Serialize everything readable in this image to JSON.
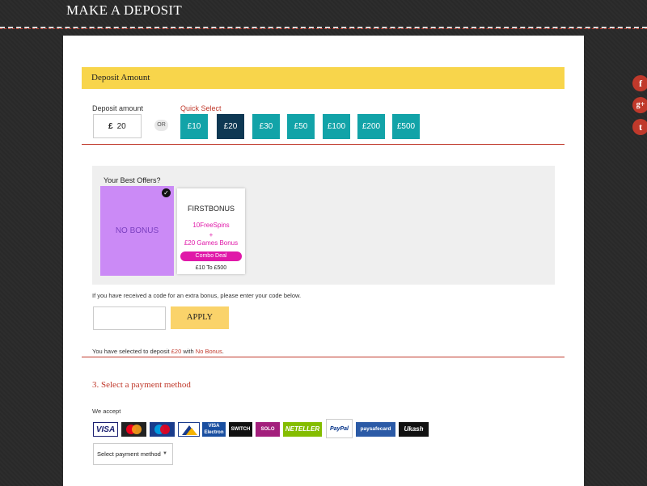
{
  "header": {
    "title": "MAKE A DEPOSIT"
  },
  "deposit": {
    "section_title": "Deposit Amount",
    "amount_label": "Deposit amount",
    "currency_symbol": "£",
    "amount_value": "20",
    "or_label": "OR",
    "quick_select_label": "Quick Select",
    "quick_options": [
      "£10",
      "£20",
      "£30",
      "£50",
      "£100",
      "£200",
      "£500"
    ],
    "quick_selected": "£20"
  },
  "offers": {
    "title": "Your Best Offers?",
    "no_bonus": {
      "label": "NO BONUS",
      "selected": true
    },
    "first_bonus": {
      "code": "FIRSTBONUS",
      "line1": "10FreeSpins",
      "line2": "+",
      "line3": "£20 Games Bonus",
      "badge": "Combo Deal",
      "range": "£10 To £500"
    }
  },
  "bonus_code": {
    "note": "If you have received a code for an extra bonus, please enter your code below.",
    "input_value": "",
    "apply_label": "APPLY"
  },
  "summary": {
    "prefix": "You have selected to deposit",
    "amount": "£20",
    "with": "with",
    "bonus": "No Bonus",
    "suffix": "."
  },
  "payment": {
    "title": "3. Select a payment method",
    "we_accept": "We accept",
    "methods": [
      {
        "name": "VISA",
        "color": "#1a1f71"
      },
      {
        "name": "MasterCard",
        "color": "#eb001b"
      },
      {
        "name": "Maestro",
        "color": "#0099df"
      },
      {
        "name": "Delta",
        "color": "#1a3c8c"
      },
      {
        "name": "VISA Electron",
        "color": "#1a1f71"
      },
      {
        "name": "SWITCH",
        "color": "#0f6b3c"
      },
      {
        "name": "SOLO",
        "color": "#a31f7c"
      },
      {
        "name": "NETELLER",
        "color": "#84bd00"
      },
      {
        "name": "PayPal",
        "color": "#003087"
      },
      {
        "name": "paysafecard",
        "color": "#2b5aa6"
      },
      {
        "name": "Ukash",
        "color": "#c00000"
      }
    ],
    "select_placeholder": "Select payment method"
  },
  "social": [
    {
      "icon": "facebook-icon",
      "glyph": "f"
    },
    {
      "icon": "google-plus-icon",
      "glyph": "g+"
    },
    {
      "icon": "twitter-icon",
      "glyph": "t"
    }
  ],
  "colors": {
    "accent": "#c0392b",
    "header_bg": "#f8d54b",
    "quick_bg": "#12a3a8",
    "quick_active": "#0e3853",
    "no_bonus_bg": "#cb8af6",
    "bonus_pink": "#e018a8",
    "apply_bg": "#fad36a"
  }
}
